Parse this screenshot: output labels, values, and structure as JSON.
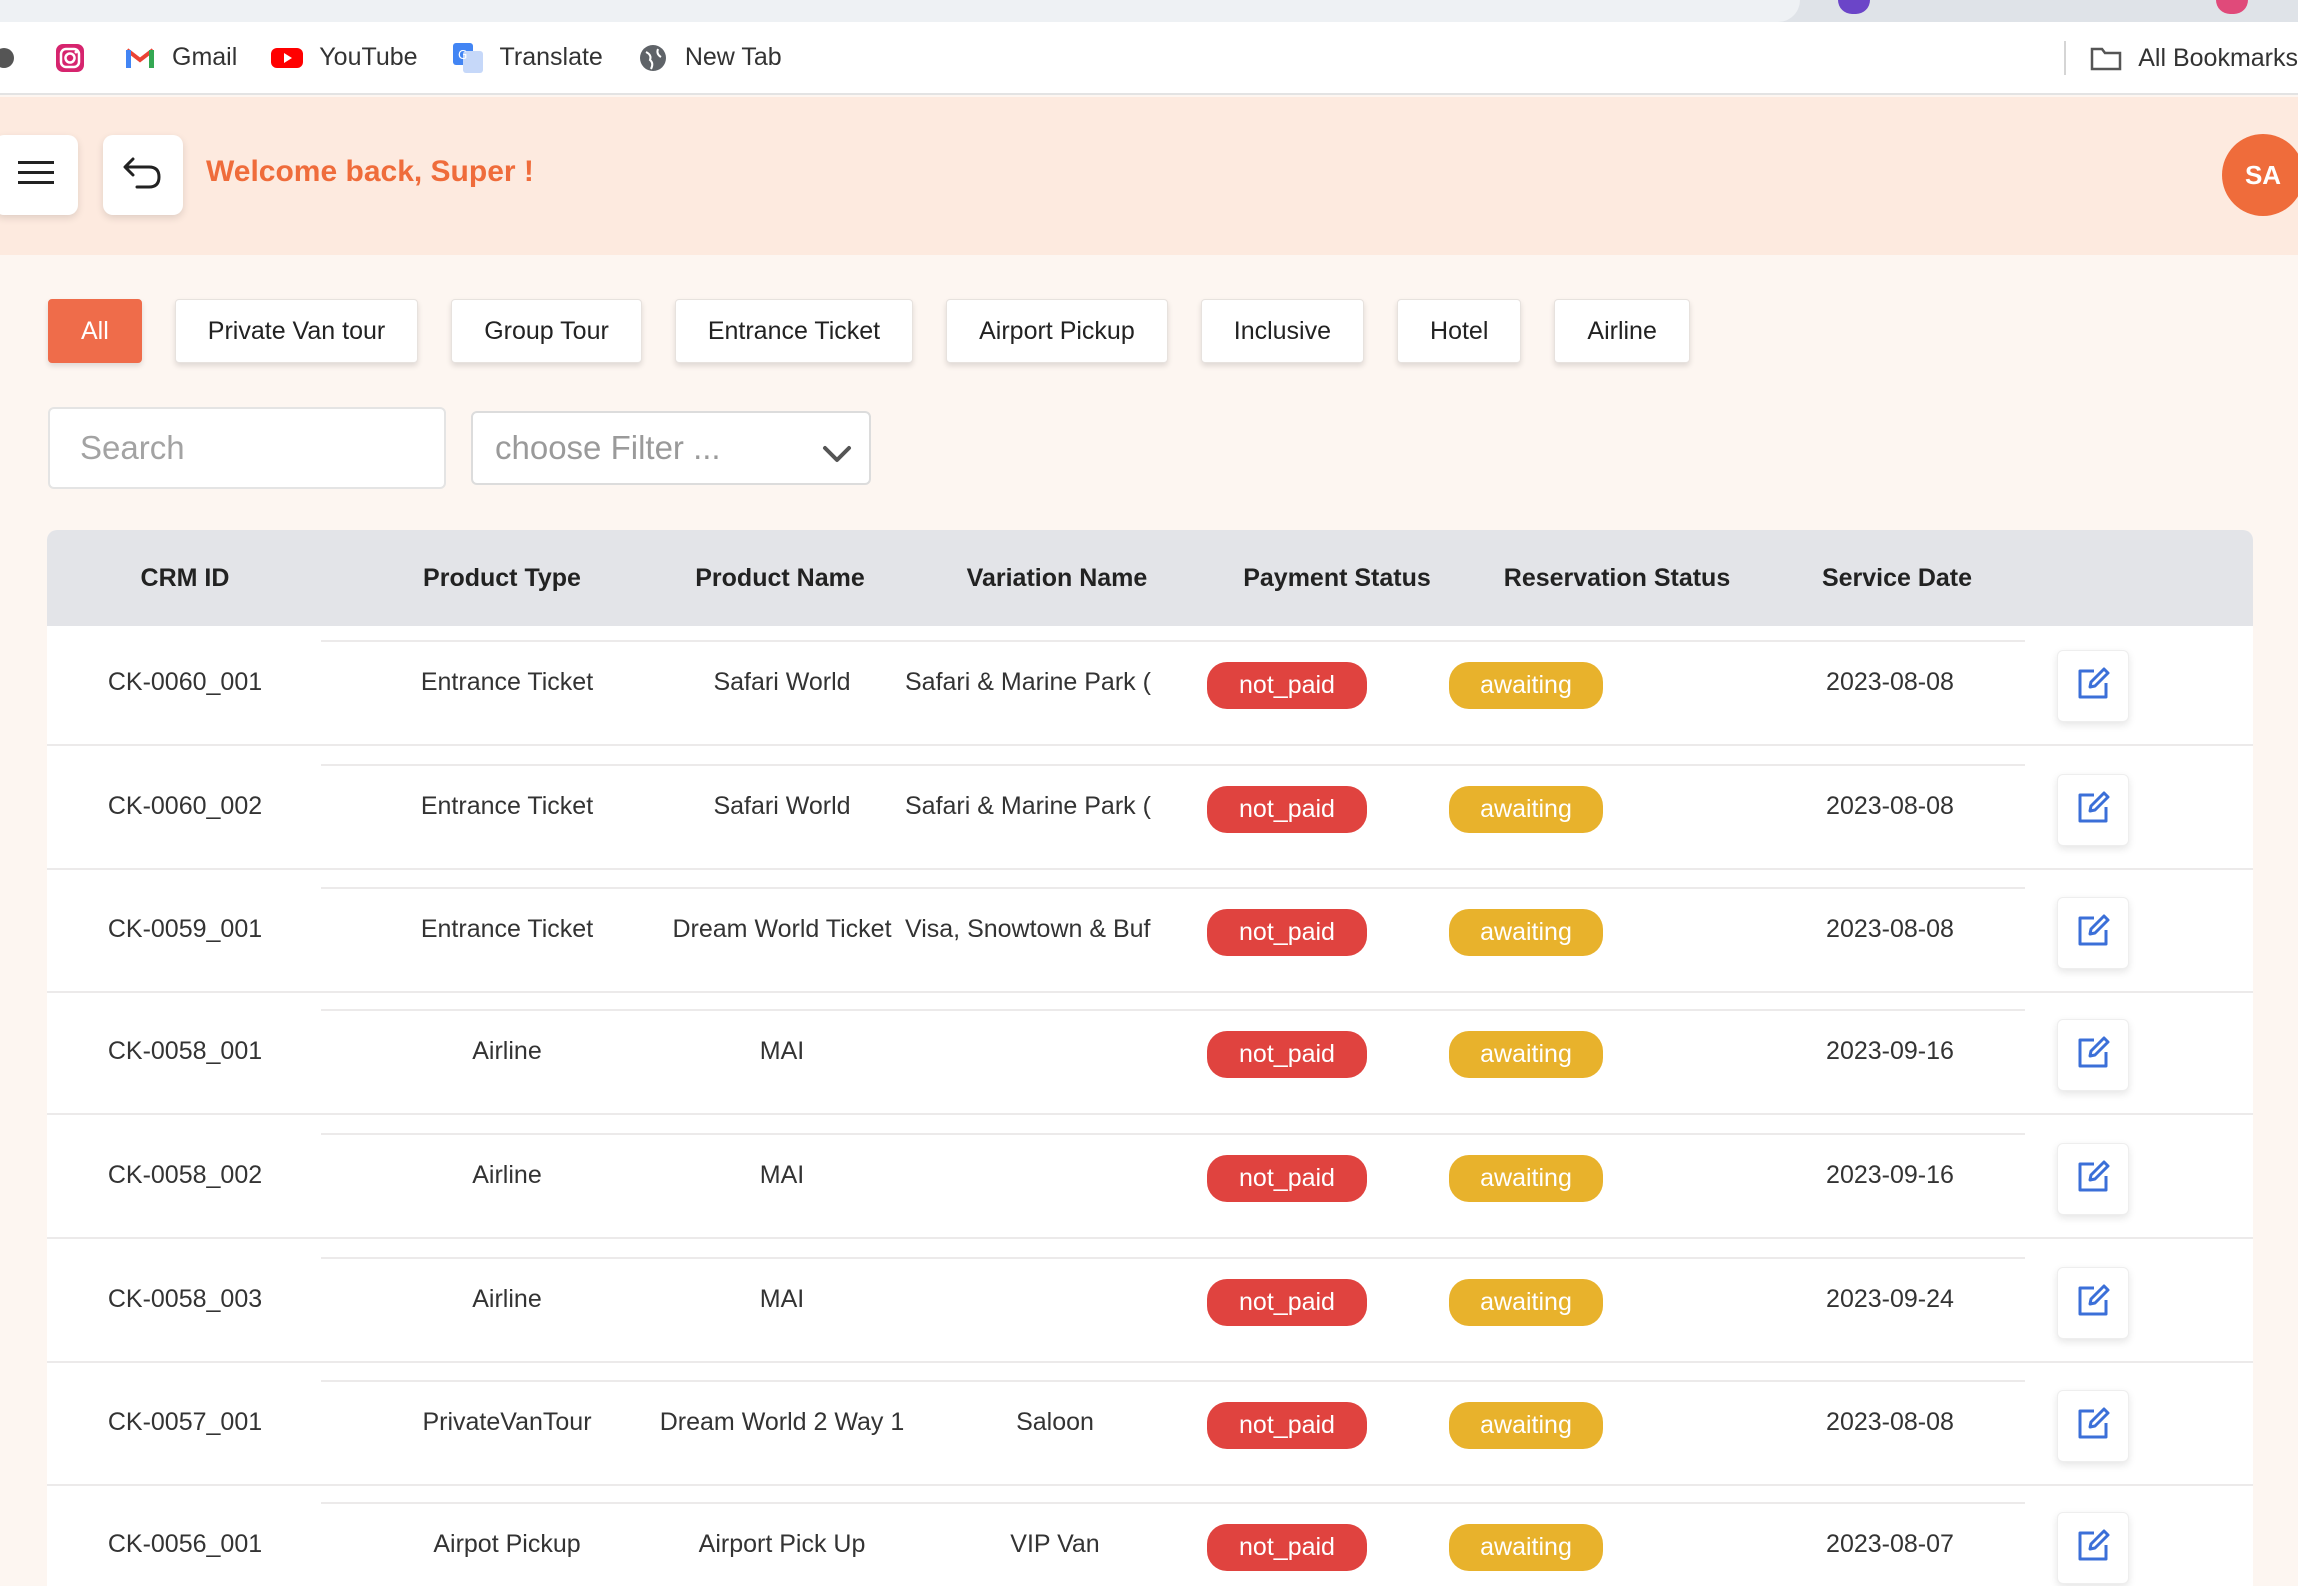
{
  "bookmarks": {
    "items": [
      {
        "label": "",
        "icon": "instagram-icon"
      },
      {
        "label": "Gmail",
        "icon": "gmail-icon"
      },
      {
        "label": "YouTube",
        "icon": "youtube-icon"
      },
      {
        "label": "Translate",
        "icon": "translate-icon"
      },
      {
        "label": "New Tab",
        "icon": "globe-icon"
      }
    ],
    "all_label": "All Bookmarks"
  },
  "header": {
    "welcome": "Welcome back, Super !",
    "avatar_initials": "SA"
  },
  "tabs": [
    "All",
    "Private Van tour",
    "Group Tour",
    "Entrance Ticket",
    "Airport Pickup",
    "Inclusive",
    "Hotel",
    "Airline"
  ],
  "active_tab": "All",
  "search": {
    "placeholder": "Search"
  },
  "filter": {
    "placeholder": "choose Filter ..."
  },
  "table": {
    "columns": [
      "CRM ID",
      "Product Type",
      "Product Name",
      "Variation Name",
      "Payment Status",
      "Reservation Status",
      "Service Date"
    ],
    "rows": [
      {
        "crm_id": "CK-0060_001",
        "product_type": "Entrance Ticket",
        "product_name": "Safari World",
        "variation": "Safari & Marine Park (",
        "payment": "not_paid",
        "reservation": "awaiting",
        "date": "2023-08-08"
      },
      {
        "crm_id": "CK-0060_002",
        "product_type": "Entrance Ticket",
        "product_name": "Safari World",
        "variation": "Safari & Marine Park (",
        "payment": "not_paid",
        "reservation": "awaiting",
        "date": "2023-08-08"
      },
      {
        "crm_id": "CK-0059_001",
        "product_type": "Entrance Ticket",
        "product_name": "Dream World Ticket",
        "variation": "Visa, Snowtown & Buf",
        "payment": "not_paid",
        "reservation": "awaiting",
        "date": "2023-08-08"
      },
      {
        "crm_id": "CK-0058_001",
        "product_type": "Airline",
        "product_name": "MAI",
        "variation": "",
        "payment": "not_paid",
        "reservation": "awaiting",
        "date": "2023-09-16"
      },
      {
        "crm_id": "CK-0058_002",
        "product_type": "Airline",
        "product_name": "MAI",
        "variation": "",
        "payment": "not_paid",
        "reservation": "awaiting",
        "date": "2023-09-16"
      },
      {
        "crm_id": "CK-0058_003",
        "product_type": "Airline",
        "product_name": "MAI",
        "variation": "",
        "payment": "not_paid",
        "reservation": "awaiting",
        "date": "2023-09-24"
      },
      {
        "crm_id": "CK-0057_001",
        "product_type": "PrivateVanTour",
        "product_name": "Dream World 2 Way 1",
        "variation": "Saloon",
        "payment": "not_paid",
        "reservation": "awaiting",
        "date": "2023-08-08"
      },
      {
        "crm_id": "CK-0056_001",
        "product_type": "Airpot Pickup",
        "product_name": "Airport Pick Up",
        "variation": "VIP Van",
        "payment": "not_paid",
        "reservation": "awaiting",
        "date": "2023-08-07"
      }
    ]
  },
  "colors": {
    "accent": "#ef6c3b",
    "not_paid": "#e0433f",
    "awaiting": "#e8b22c",
    "edit_icon": "#3b6fd8"
  }
}
